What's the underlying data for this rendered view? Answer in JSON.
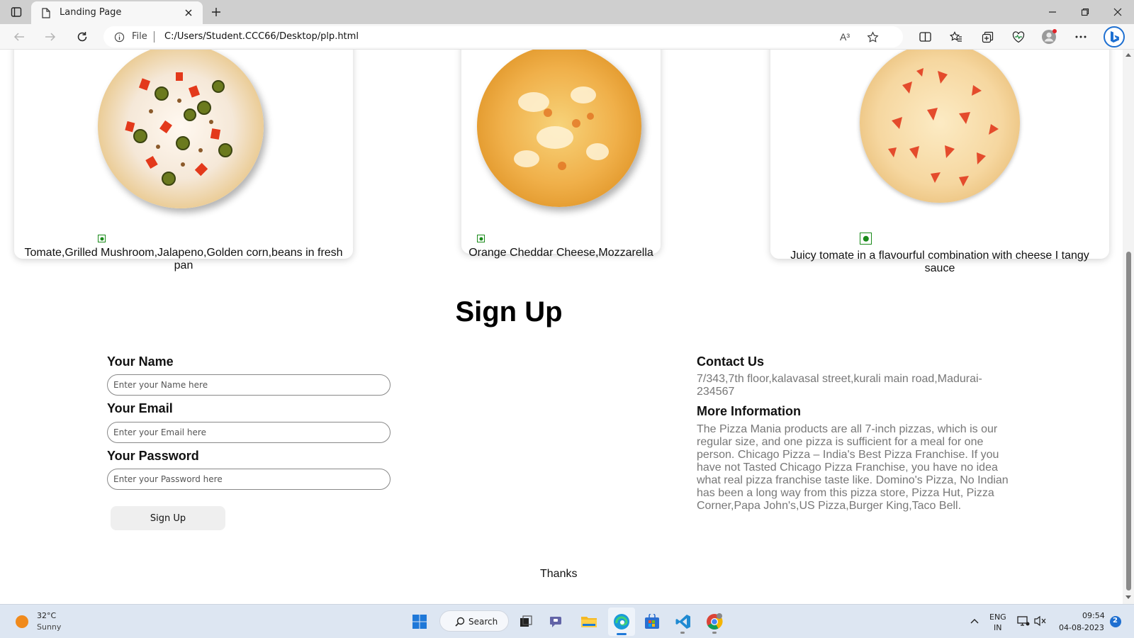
{
  "browser": {
    "tab_title": "Landing Page",
    "url_prefix": "File",
    "url": "C:/Users/Student.CCC66/Desktop/plp.html",
    "read_aloud_icon": "A³"
  },
  "pizzas": [
    {
      "description": "Tomate,Grilled Mushroom,Jalapeno,Golden corn,beans in fresh pan"
    },
    {
      "description": "Orange Cheddar Cheese,Mozzarella"
    },
    {
      "description": "Juicy tomate in a flavourful combination with cheese I tangy sauce"
    }
  ],
  "signup": {
    "title": "Sign Up",
    "name_label": "Your Name",
    "name_placeholder": "Enter your Name here",
    "email_label": "Your Email",
    "email_placeholder": "Enter your Email here",
    "password_label": "Your Password",
    "password_placeholder": "Enter your Password here",
    "button_label": "Sign Up"
  },
  "contact": {
    "heading": "Contact Us",
    "address": "7/343,7th floor,kalavasal street,kurali main road,Madurai-234567",
    "more_heading": "More Information",
    "more_text": "The Pizza Mania products are all 7-inch pizzas, which is our regular size, and one pizza is sufficient for a meal for one person. Chicago Pizza – India's Best Pizza Franchise. If you have not Tasted Chicago Pizza Franchise, you have no idea what real pizza franchise taste like. Domino's Pizza, No Indian has been a long way from this pizza store, Pizza Hut, Pizza Corner,Papa John's,US Pizza,Burger King,Taco Bell."
  },
  "footer": {
    "thanks": "Thanks"
  },
  "taskbar": {
    "weather_temp": "32°C",
    "weather_desc": "Sunny",
    "search_label": "Search",
    "lang_top": "ENG",
    "lang_bottom": "IN",
    "time": "09:54",
    "date": "04-08-2023",
    "notification_count": "2"
  }
}
